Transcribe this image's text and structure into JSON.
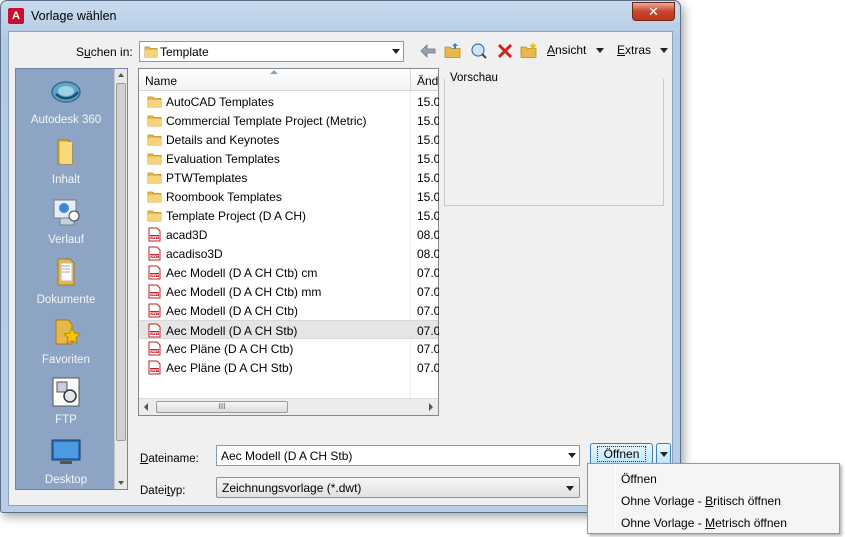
{
  "window": {
    "title": "Vorlage wählen",
    "close_label": "✕"
  },
  "lookin": {
    "label_prefix": "S",
    "label_underlined": "u",
    "label_suffix": "chen in:",
    "value": "Template"
  },
  "toolbar": {
    "view_label_prefix": "",
    "view_label_u": "A",
    "view_label_suffix": "nsicht",
    "tools_label_prefix": "",
    "tools_label_u": "E",
    "tools_label_suffix": "xtras"
  },
  "places": [
    {
      "label": "Autodesk 360",
      "icon": "autodesk-360-icon"
    },
    {
      "label": "Inhalt",
      "icon": "folder-icon"
    },
    {
      "label": "Verlauf",
      "icon": "history-icon"
    },
    {
      "label": "Dokumente",
      "icon": "documents-icon"
    },
    {
      "label": "Favoriten",
      "icon": "favorites-icon"
    },
    {
      "label": "FTP",
      "icon": "ftp-icon"
    },
    {
      "label": "Desktop",
      "icon": "desktop-icon"
    }
  ],
  "filelist": {
    "columns": {
      "name": "Name",
      "date": "Änd"
    },
    "rows": [
      {
        "name": "AutoCAD Templates",
        "date": "15.0",
        "type": "folder"
      },
      {
        "name": "Commercial Template Project (Metric)",
        "date": "15.0",
        "type": "folder"
      },
      {
        "name": "Details and Keynotes",
        "date": "15.0",
        "type": "folder"
      },
      {
        "name": "Evaluation Templates",
        "date": "15.0",
        "type": "folder"
      },
      {
        "name": "PTWTemplates",
        "date": "15.0",
        "type": "folder"
      },
      {
        "name": "Roombook Templates",
        "date": "15.0",
        "type": "folder"
      },
      {
        "name": "Template Project (D A CH)",
        "date": "15.0",
        "type": "folder"
      },
      {
        "name": "acad3D",
        "date": "08.0",
        "type": "dwt"
      },
      {
        "name": "acadiso3D",
        "date": "08.0",
        "type": "dwt"
      },
      {
        "name": "Aec Modell (D A CH Ctb) cm",
        "date": "07.0",
        "type": "dwt"
      },
      {
        "name": "Aec Modell (D A CH Ctb) mm",
        "date": "07.0",
        "type": "dwt"
      },
      {
        "name": "Aec Modell (D A CH Ctb)",
        "date": "07.0",
        "type": "dwt"
      },
      {
        "name": "Aec Modell (D A CH Stb)",
        "date": "07.0",
        "type": "dwt",
        "selected": true
      },
      {
        "name": "Aec Pläne (D A CH Ctb)",
        "date": "07.0",
        "type": "dwt"
      },
      {
        "name": "Aec Pläne (D A CH Stb)",
        "date": "07.0",
        "type": "dwt"
      }
    ],
    "hscroll_grip": "III"
  },
  "preview": {
    "label": "Vorschau"
  },
  "filename": {
    "label_prefix": "",
    "label_u": "D",
    "label_suffix": "ateiname:",
    "value": "Aec Modell (D A CH Stb)"
  },
  "filetype": {
    "label_prefix": "Datei",
    "label_u": "t",
    "label_suffix": "yp:",
    "value": "Zeichnungsvorlage (*.dwt)"
  },
  "open_button": {
    "label": "Öffnen"
  },
  "open_menu": {
    "items": [
      {
        "prefix": "Öffnen",
        "u": "",
        "suffix": ""
      },
      {
        "prefix": "Ohne Vorlage - ",
        "u": "B",
        "suffix": "ritisch öffnen"
      },
      {
        "prefix": "Ohne Vorlage - ",
        "u": "M",
        "suffix": "etrisch öffnen"
      }
    ]
  },
  "colors": {
    "places_bg": "#8da4c4",
    "title_close": "#c9452c",
    "button_border": "#3c7fb1"
  }
}
